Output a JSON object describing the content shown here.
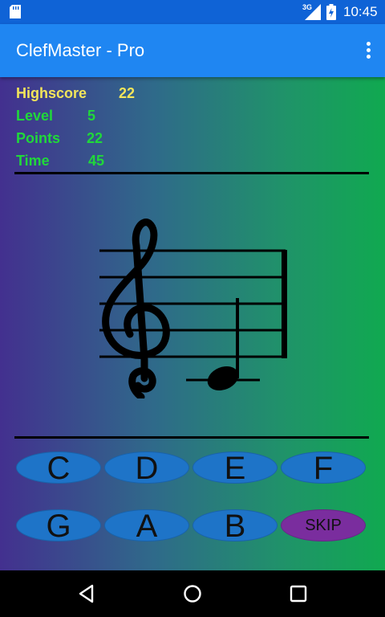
{
  "status": {
    "time": "10:45",
    "network": "3G"
  },
  "app": {
    "title": "ClefMaster - Pro"
  },
  "stats": {
    "highscore": {
      "label": "Highscore",
      "value": "22"
    },
    "level": {
      "label": "Level",
      "value": "5"
    },
    "points": {
      "label": "Points",
      "value": "22"
    },
    "time": {
      "label": "Time",
      "value": "45"
    }
  },
  "notes": [
    "C",
    "D",
    "E",
    "F",
    "G",
    "A",
    "B"
  ],
  "skip_label": "SKIP",
  "colors": {
    "status_bar": "#0F63D6",
    "app_bar": "#1F86F2",
    "highscore": "#F2E55A",
    "stat_green": "#20D83A",
    "button_blue": "#1E74C8",
    "skip_purple": "#7A2D9E"
  },
  "icons": {
    "sd": "sd-card-icon",
    "signal": "signal-icon",
    "battery": "battery-icon",
    "back": "back-icon",
    "home": "home-icon",
    "recents": "recents-icon",
    "menu": "more-vert-icon"
  }
}
